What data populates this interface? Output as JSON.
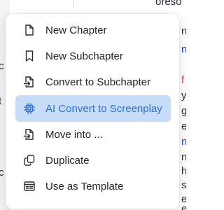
{
  "background": {
    "left_fragments": [
      "c",
      "t",
      "c"
    ],
    "right_fragments": [
      "oreso",
      "n",
      "n",
      "f",
      "y",
      "g",
      "e",
      "n",
      "n",
      "h",
      "s",
      "e",
      "e"
    ]
  },
  "menu": {
    "items": [
      {
        "label": "New Chapter",
        "icon": "file-icon",
        "active": false
      },
      {
        "label": "New Subchapter",
        "icon": "bookmark-icon",
        "active": false
      },
      {
        "label": "Convert to Subchapter",
        "icon": "file-convert-icon",
        "active": false
      },
      {
        "label": "AI Convert to Screenplay",
        "icon": "cpu-chip-icon",
        "active": true
      },
      {
        "label": "Move into ...",
        "icon": "file-move-icon",
        "active": false
      },
      {
        "label": "Duplicate",
        "icon": "duplicate-icon",
        "active": false
      },
      {
        "label": "Use as Template",
        "icon": "template-icon",
        "active": false
      }
    ]
  },
  "colors": {
    "accent": "#2e6fd8",
    "active_bg": "#c7dcf7",
    "text": "#23232b"
  }
}
